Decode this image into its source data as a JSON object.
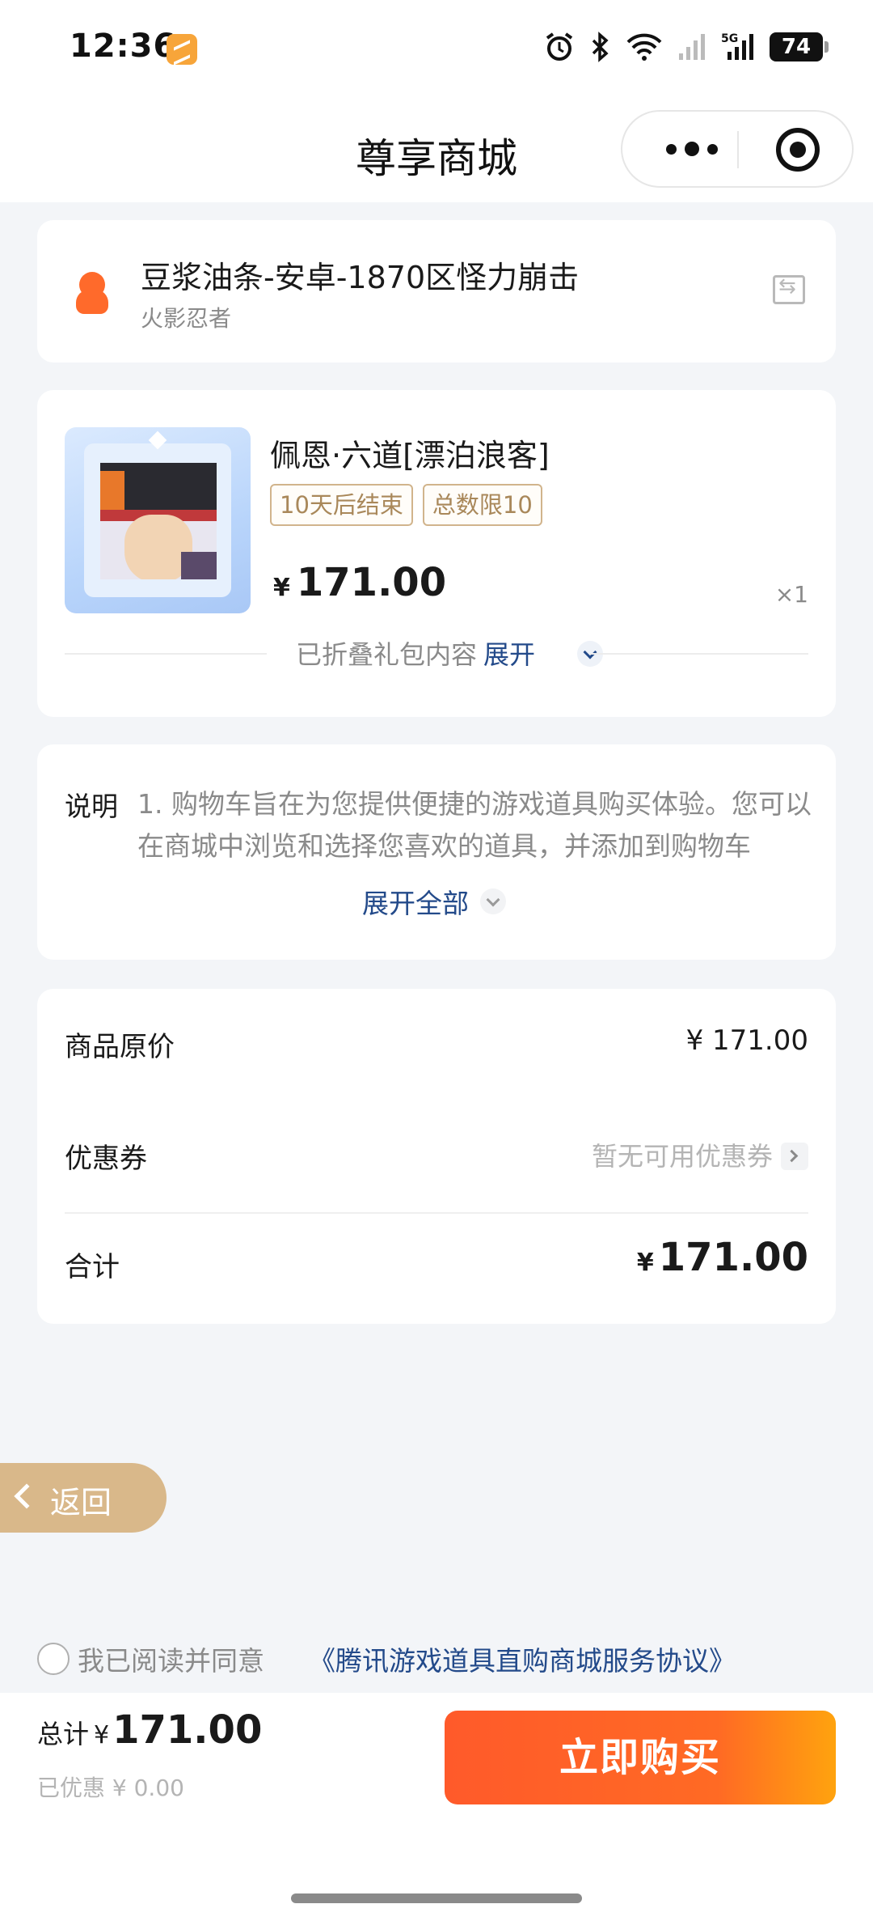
{
  "status_bar": {
    "time": "12:36",
    "battery": "74",
    "network": "5G"
  },
  "nav": {
    "title": "尊享商城"
  },
  "account": {
    "name": "豆浆油条-安卓-1870区怪力崩击",
    "game": "火影忍者"
  },
  "product": {
    "name": "佩恩·六道[漂泊浪客]",
    "tags": [
      "10天后结束",
      "总数限10"
    ],
    "currency": "¥",
    "price": "171.00",
    "quantity": "×1",
    "folded_text": "已折叠礼包内容",
    "expand_label": "展开"
  },
  "description": {
    "label": "说明",
    "text": "1. 购物车旨在为您提供便捷的游戏道具购买体验。您可以在商城中浏览和选择您喜欢的道具，并添加到购物车",
    "expand_all": "展开全部"
  },
  "pricing": {
    "original_label": "商品原价",
    "original_value": "¥ 171.00",
    "coupon_label": "优惠券",
    "coupon_value": "暂无可用优惠券",
    "total_label": "合计",
    "total_currency": "¥",
    "total_value": "171.00"
  },
  "back": {
    "label": "返回"
  },
  "agreement": {
    "text": "我已阅读并同意",
    "link": "《腾讯游戏道具直购商城服务协议》"
  },
  "bottom": {
    "total_label": "总计",
    "currency": "¥",
    "total_value": "171.00",
    "saved": "已优惠 ¥ 0.00",
    "buy_label": "立即购买"
  },
  "colors": {
    "accent_orange": "#ff5a2a",
    "link_blue": "#234a8a",
    "tag_gold": "#a9885a",
    "back_tan": "#d9b88a"
  }
}
